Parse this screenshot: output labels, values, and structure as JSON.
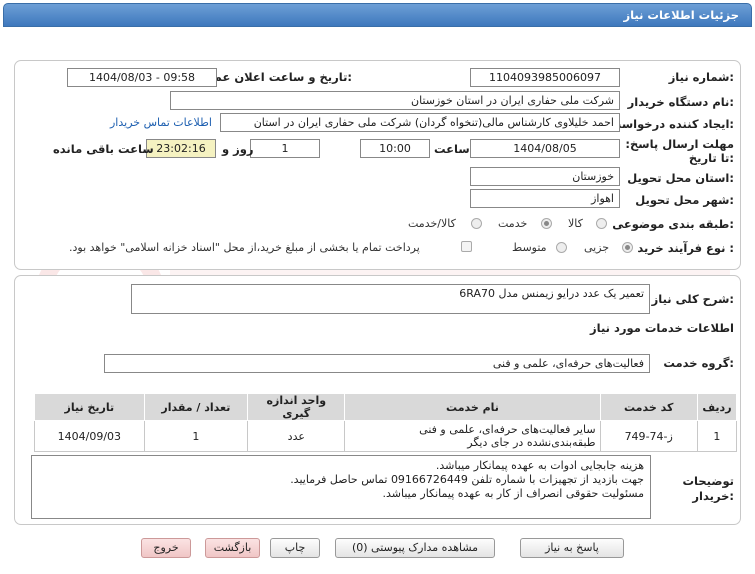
{
  "window": {
    "title": "جزئیات اطلاعات نیاز"
  },
  "form": {
    "need_number_label": "شماره نیاز:",
    "need_number": "1104093985006097",
    "announce_label": "تاریخ و ساعت اعلان عمومی:",
    "announce_value": "1404/08/03 - 09:58",
    "buyer_label": "نام دستگاه خریدار:",
    "buyer_value": "شرکت ملی حفاری ایران در استان خوزستان",
    "creator_label": "ایجاد کننده درخواست:",
    "creator_value": "احمد خلیلاوی کارشناس مالی(تنخواه گردان) شرکت ملی حفاری ایران در استان",
    "contact_link": "اطلاعات تماس خریدار",
    "deadline_label": "مهلت ارسال پاسخ: تا تاریخ:",
    "deadline_date": "1404/08/05",
    "time_label": "ساعت",
    "deadline_time": "10:00",
    "days_value": "1",
    "days_label": "روز و",
    "remaining_value": "23:02:16",
    "remaining_label": "ساعت باقی مانده",
    "province_label": "استان محل تحویل:",
    "province_value": "خوزستان",
    "city_label": "شهر محل تحویل:",
    "city_value": "اهواز",
    "category_label": "طبقه بندی موضوعی:",
    "category_options": [
      "کالا",
      "خدمت",
      "کالا/خدمت"
    ],
    "process_label": "نوع فرآیند خرید :",
    "process_options": [
      "جزیی",
      "متوسط"
    ],
    "payment_note": "پرداخت تمام یا بخشی از مبلغ خرید،از محل \"اسناد خزانه اسلامی\" خواهد بود."
  },
  "summary": {
    "label": "شرح کلی نیاز:",
    "value": "تعمیر یک عدد درایو زیمنس مدل 6RA70"
  },
  "services": {
    "section_title": "اطلاعات خدمات مورد نیاز",
    "group_label": "گروه خدمت:",
    "group_value": "فعالیت‌های حرفه‌ای، علمی و فنی",
    "columns": [
      "ردیف",
      "کد خدمت",
      "نام خدمت",
      "واحد اندازه گیری",
      "تعداد / مقدار",
      "تاریخ نیاز"
    ],
    "rows": [
      {
        "row": "1",
        "code": "ز-74-749",
        "name": "سایر فعالیت‌های حرفه‌ای، علمی و فنی طبقه‌بندی‌نشده در جای دیگر",
        "unit": "عدد",
        "qty": "1",
        "date": "1404/09/03"
      }
    ]
  },
  "buyer_notes": {
    "label": "توضیحات خریدار:",
    "line1": "هزینه جابجایی ادوات به عهده پیمانکار میباشد.",
    "line2": "جهت بازدید از تجهیزات با شماره تلفن 09166726449 تماس حاصل فرمایید.",
    "line3": "مسئولیت حقوقی انصراف از کار به عهده پیمانکار میباشد."
  },
  "buttons": {
    "reply": "پاسخ به نیاز",
    "view_docs": "مشاهده مدارک پیوستی (0)",
    "print": "چاپ",
    "back": "بازگشت",
    "exit": "خروج"
  },
  "colors": {
    "title_bar": "#3e78bd",
    "remaining_bg": "#f5f2c1",
    "link": "#1d5fb0"
  }
}
